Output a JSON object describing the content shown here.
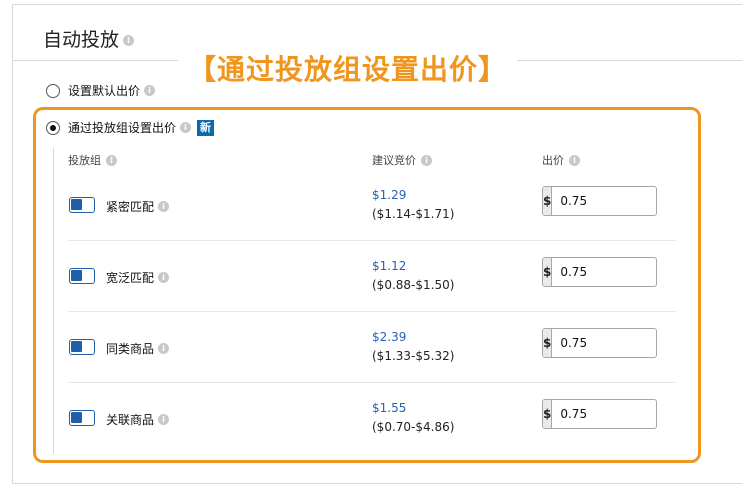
{
  "panel": {
    "title": "自动投放"
  },
  "banner": {
    "text": "【通过投放组设置出价】"
  },
  "options": [
    {
      "label": "设置默认出价",
      "checked": false
    },
    {
      "label": "通过投放组设置出价",
      "checked": true,
      "badge": "新"
    }
  ],
  "table": {
    "headers": {
      "group": "投放组",
      "suggested": "建议竞价",
      "bid": "出价"
    },
    "rows": [
      {
        "name": "紧密匹配",
        "suggested": "$1.29",
        "range": "($1.14-$1.71)",
        "currency": "$",
        "bid": "0.75",
        "enabled": true
      },
      {
        "name": "宽泛匹配",
        "suggested": "$1.12",
        "range": "($0.88-$1.50)",
        "currency": "$",
        "bid": "0.75",
        "enabled": true
      },
      {
        "name": "同类商品",
        "suggested": "$2.39",
        "range": "($1.33-$5.32)",
        "currency": "$",
        "bid": "0.75",
        "enabled": true
      },
      {
        "name": "关联商品",
        "suggested": "$1.55",
        "range": "($0.70-$4.86)",
        "currency": "$",
        "bid": "0.75",
        "enabled": true
      }
    ]
  },
  "colors": {
    "highlight": "#f0961e",
    "link": "#2363b3",
    "badge": "#0a6ab0",
    "toggle": "#1f5fa8"
  }
}
